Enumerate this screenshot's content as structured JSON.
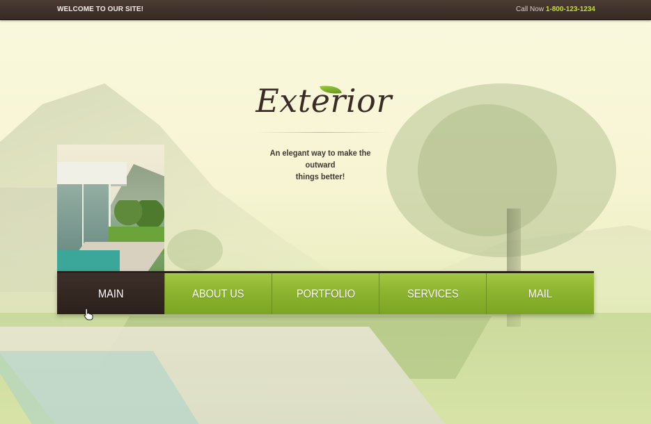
{
  "topbar": {
    "welcome": "WELCOME TO OUR SITE!",
    "call_label": "Call Now",
    "phone": "1-800-123-1234"
  },
  "branding": {
    "logo_text": "Exterior",
    "tagline_line1": "An elegant way to make the outward",
    "tagline_line2": "things better!"
  },
  "nav": {
    "items": [
      {
        "label": "MAIN",
        "active": true
      },
      {
        "label": "ABOUT US",
        "active": false
      },
      {
        "label": "PORTFOLIO",
        "active": false
      },
      {
        "label": "SERVICES",
        "active": false
      },
      {
        "label": "MAIL",
        "active": false
      }
    ]
  },
  "colors": {
    "accent_green": "#8db42f",
    "dark_brown": "#2b201b",
    "phone_highlight": "#c2e02a"
  },
  "icons": {
    "cursor": "hand-pointer-icon",
    "logo_leaf": "leaf-icon"
  }
}
